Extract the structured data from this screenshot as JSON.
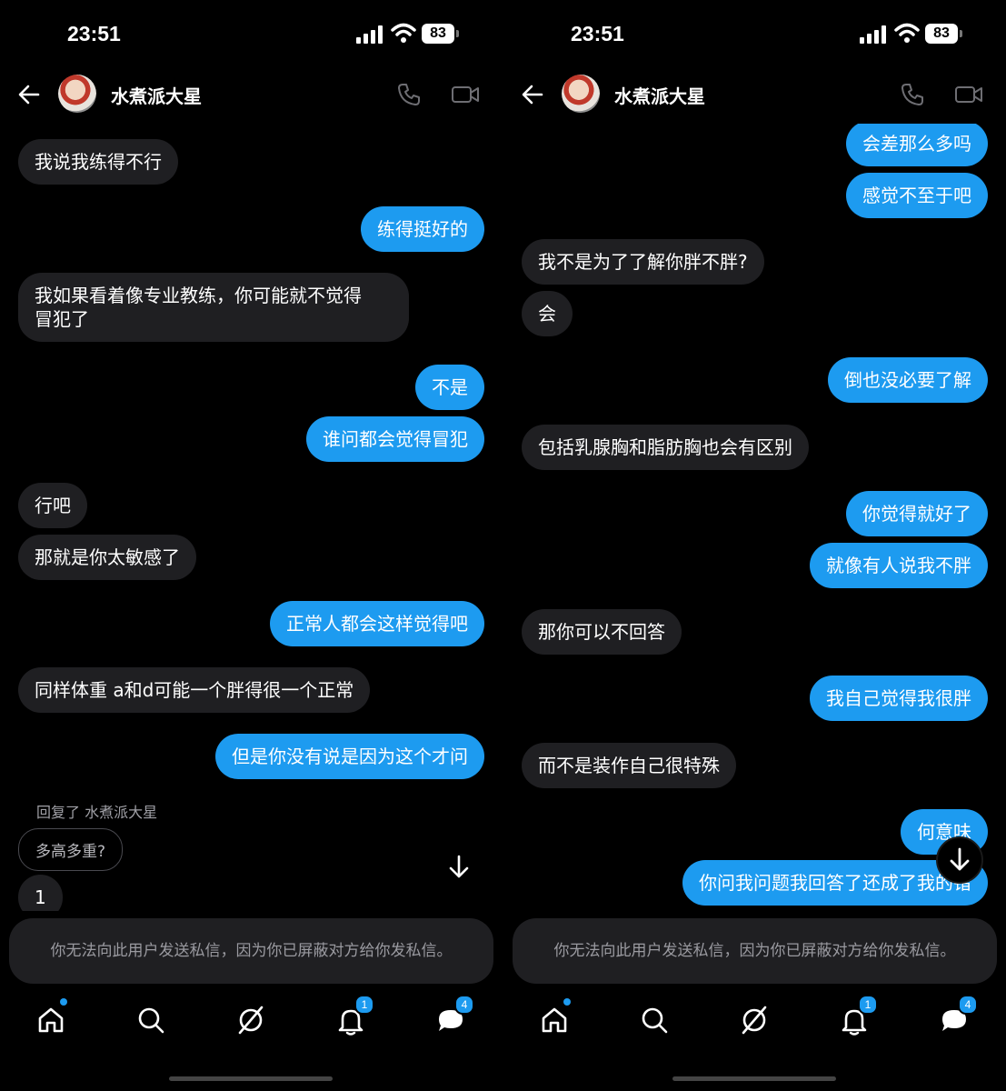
{
  "status": {
    "time": "23:51",
    "battery": "83"
  },
  "contact": {
    "name": "水煮派大星"
  },
  "notice": "你无法向此用户发送私信，因为你已屏蔽对方给你发私信。",
  "tabs": {
    "notifications_badge": "1",
    "messages_badge": "4"
  },
  "left": {
    "messages": [
      {
        "dir": "in",
        "text": "我说我练得不行"
      },
      {
        "dir": "out",
        "text": "练得挺好的"
      },
      {
        "dir": "in",
        "text": "我如果看着像专业教练，你可能就不觉得\n冒犯了"
      },
      {
        "dir": "out",
        "text": "不是"
      },
      {
        "dir": "out",
        "text": "谁问都会觉得冒犯"
      },
      {
        "dir": "in",
        "text": "行吧"
      },
      {
        "dir": "in",
        "text": "那就是你太敏感了"
      },
      {
        "dir": "out",
        "text": "正常人都会这样觉得吧"
      },
      {
        "dir": "in",
        "text": "同样体重 a和d可能一个胖得很一个正常"
      },
      {
        "dir": "out",
        "text": "但是你没有说是因为这个才问"
      },
      {
        "dir": "in",
        "text": "1"
      }
    ],
    "reply": {
      "label": "回复了 水煮派大星",
      "quoted": "多高多重?"
    }
  },
  "right": {
    "messages": [
      {
        "dir": "out",
        "text": "会差那么多吗"
      },
      {
        "dir": "out",
        "text": "感觉不至于吧"
      },
      {
        "dir": "in",
        "text": "我不是为了了解你胖不胖?"
      },
      {
        "dir": "in",
        "text": "会"
      },
      {
        "dir": "out",
        "text": "倒也没必要了解"
      },
      {
        "dir": "in",
        "text": "包括乳腺胸和脂肪胸也会有区别"
      },
      {
        "dir": "out",
        "text": "你觉得就好了"
      },
      {
        "dir": "out",
        "text": "就像有人说我不胖"
      },
      {
        "dir": "in",
        "text": "那你可以不回答"
      },
      {
        "dir": "out",
        "text": "我自己觉得我很胖"
      },
      {
        "dir": "in",
        "text": "而不是装作自己很特殊"
      },
      {
        "dir": "out",
        "text": "何意味"
      },
      {
        "dir": "out",
        "text": "你问我问题我回答了还成了我的错"
      }
    ]
  }
}
